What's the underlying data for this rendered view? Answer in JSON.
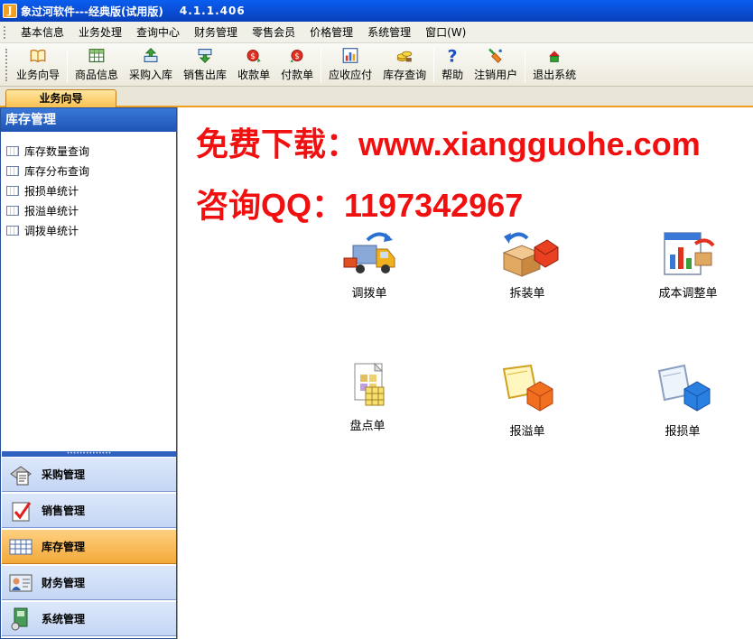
{
  "titlebar": {
    "title": "象过河软件---经典版(试用版)",
    "version": "4.1.1.406",
    "icon_letter": "J"
  },
  "menu": [
    "基本信息",
    "业务处理",
    "查询中心",
    "财务管理",
    "零售会员",
    "价格管理",
    "系统管理",
    "窗口(W)"
  ],
  "toolbar": [
    {
      "label": "业务向导",
      "icon": "book-icon"
    },
    {
      "label": "商品信息",
      "icon": "grid-icon"
    },
    {
      "label": "采购入库",
      "icon": "inbox-up-icon"
    },
    {
      "label": "销售出库",
      "icon": "outbox-down-icon"
    },
    {
      "label": "收款单",
      "icon": "receive-money-icon"
    },
    {
      "label": "付款单",
      "icon": "pay-money-icon"
    },
    {
      "label": "应收应付",
      "icon": "chart-icon"
    },
    {
      "label": "库存查询",
      "icon": "coins-icon"
    },
    {
      "label": "帮助",
      "icon": "help-icon"
    },
    {
      "label": "注销用户",
      "icon": "logout-user-icon"
    },
    {
      "label": "退出系统",
      "icon": "exit-icon"
    }
  ],
  "tab": {
    "label": "业务向导"
  },
  "sidebar": {
    "title": "库存管理",
    "items": [
      "库存数量查询",
      "库存分布查询",
      "报损单统计",
      "报溢单统计",
      "调拨单统计"
    ],
    "groups": [
      {
        "label": "采购管理",
        "icon": "purchase-icon",
        "active": false
      },
      {
        "label": "销售管理",
        "icon": "sales-check-icon",
        "active": false
      },
      {
        "label": "库存管理",
        "icon": "inventory-grid-icon",
        "active": true
      },
      {
        "label": "财务管理",
        "icon": "finance-person-icon",
        "active": false
      },
      {
        "label": "系统管理",
        "icon": "system-icon",
        "active": false
      }
    ]
  },
  "main": {
    "promo_line1": "免费下载：www.xiangguohe.com",
    "promo_line2": "咨询QQ：1197342967",
    "functions": [
      {
        "label": "调拨单",
        "icon": "truck-icon"
      },
      {
        "label": "拆装单",
        "icon": "boxes-icon"
      },
      {
        "label": "成本调整单",
        "icon": "cost-adjust-icon"
      },
      {
        "label": "盘点单",
        "icon": "stocktake-icon"
      },
      {
        "label": "报溢单",
        "icon": "overflow-box-icon"
      },
      {
        "label": "报损单",
        "icon": "loss-box-icon"
      }
    ]
  },
  "colors": {
    "accent": "#f0a020",
    "title_blue": "#0a4fd8",
    "promo_red": "#f01010"
  }
}
